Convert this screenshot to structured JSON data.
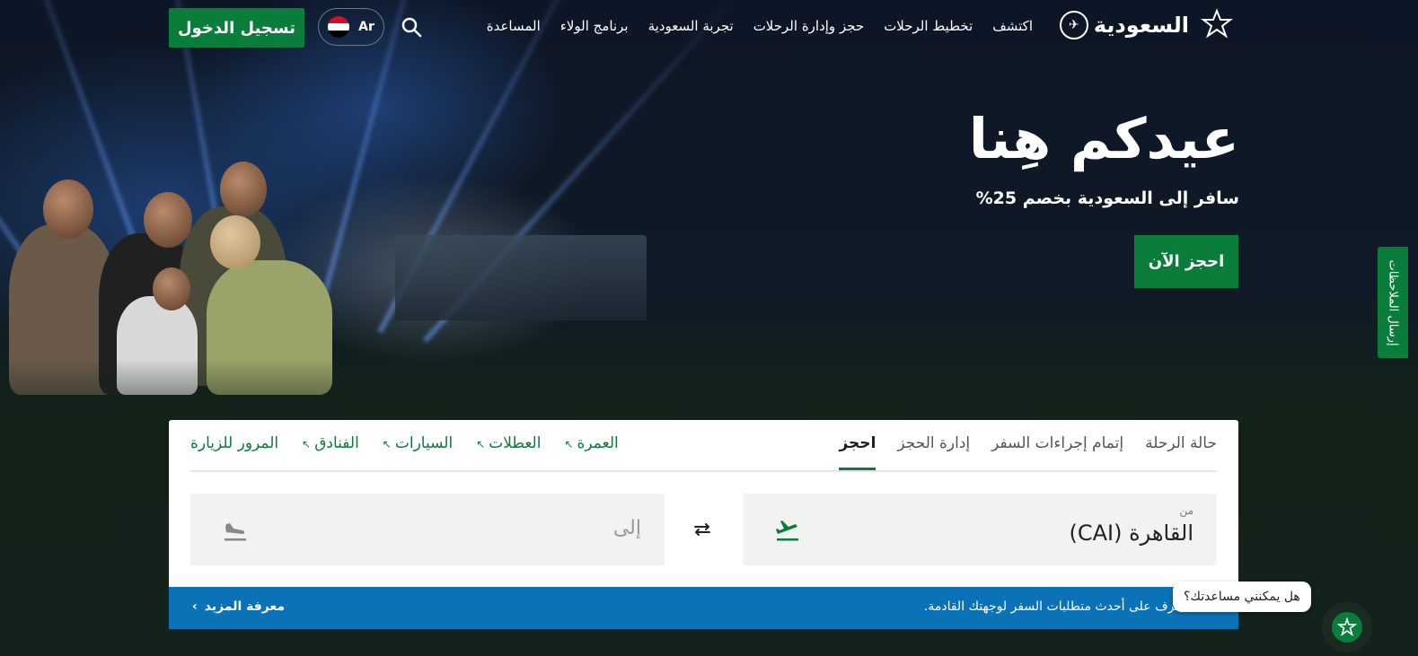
{
  "header": {
    "logo_text": "السعودية",
    "nav": [
      "اكتشف",
      "تخطيط الرحلات",
      "حجز وإدارة الرحلات",
      "تجربة السعودية",
      "برنامج الولاء",
      "المساعدة"
    ],
    "language": "Ar",
    "login_label": "تسجيل الدخول"
  },
  "hero": {
    "title": "عيدكم هِنا",
    "subtitle": "سافر إلى السعودية بخصم 25%",
    "cta_label": "احجز الآن"
  },
  "feedback_label": "إرسال الملاحظات",
  "booking": {
    "tabs": [
      "احجز",
      "إدارة الحجز",
      "إتمام إجراءات السفر",
      "حالة الرحلة"
    ],
    "active_tab": "احجز",
    "external_links": [
      "المرور للزيارة",
      "الفنادق",
      "السيارات",
      "العطلات",
      "العمرة"
    ],
    "from_label": "من",
    "from_value": "القاهرة (CAI)",
    "to_placeholder": "إلى"
  },
  "notice": {
    "text": "تعرف على أحدث متطلبات السفر لوجهتك القادمة.",
    "link_label": "معرفة المزيد"
  },
  "chat": {
    "bubble_text": "هل يمكنني مساعدتك؟"
  },
  "colors": {
    "brand_green": "#0a7d3b",
    "notice_blue": "#0c72b7"
  }
}
